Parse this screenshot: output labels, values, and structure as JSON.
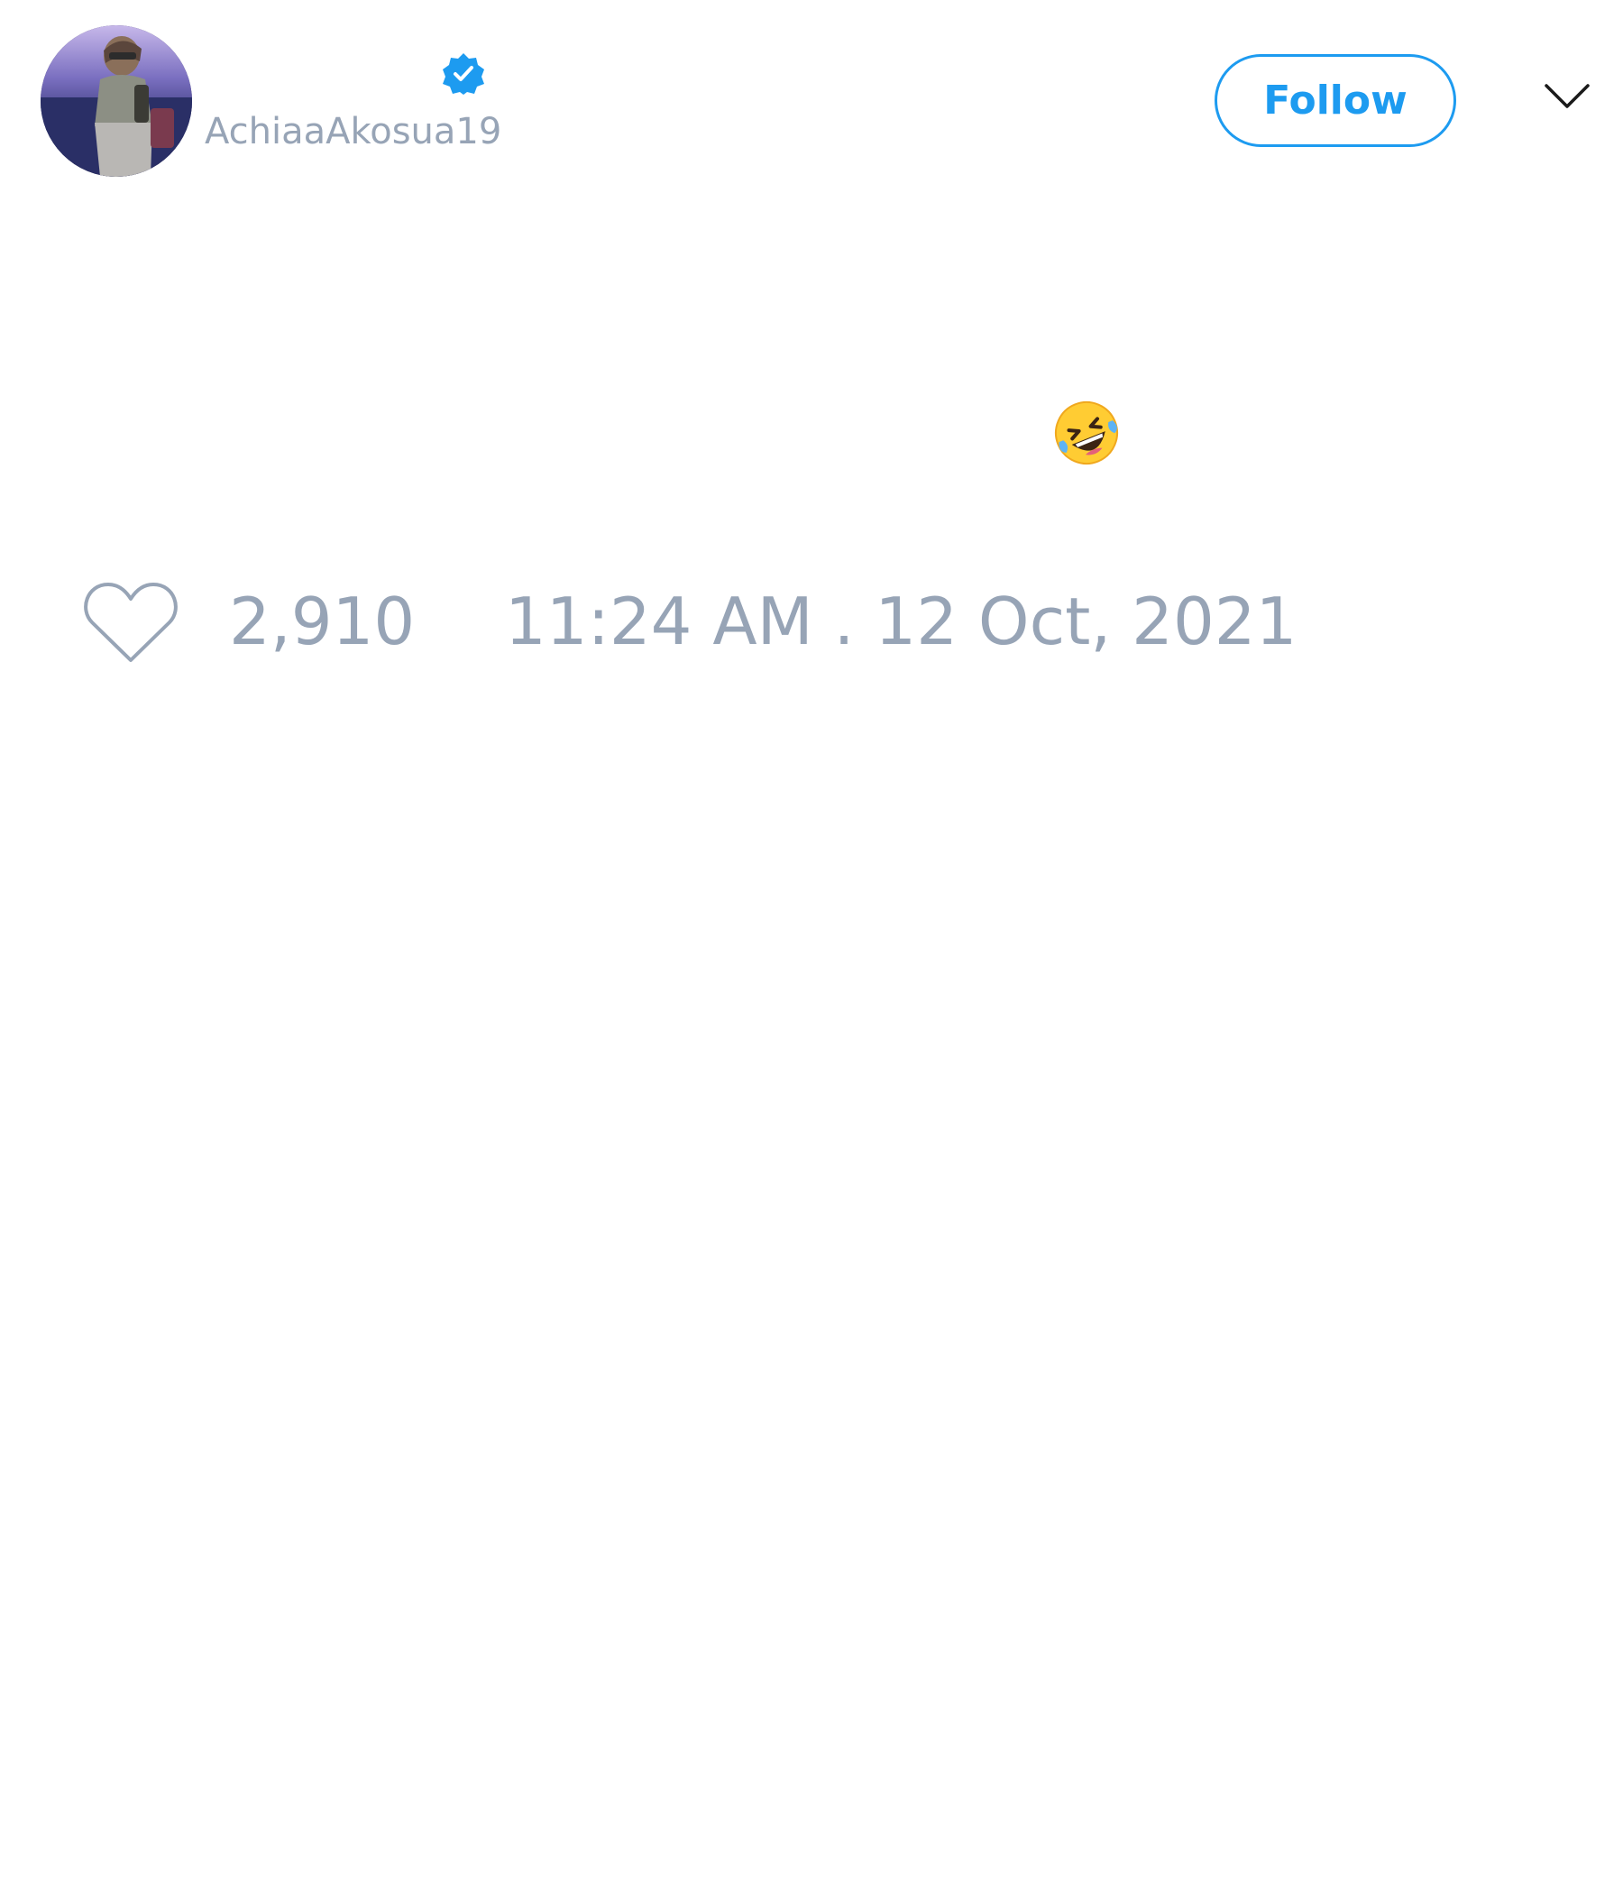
{
  "theme": {
    "accent": "#1d9bf0",
    "muted_text": "#97a4b6",
    "chevron": "#1a1a1a",
    "background": "#ffffff"
  },
  "header": {
    "username": "AchiaaAkosua19",
    "verified": true,
    "follow_label": "Follow",
    "menu_icon": "chevron-down-icon"
  },
  "tweet": {
    "emoji": "rolling-on-the-floor-laughing-emoji"
  },
  "footer": {
    "like_icon": "heart-icon",
    "like_count": "2,910",
    "timestamp": "11:24 AM . 12 Oct, 2021"
  }
}
